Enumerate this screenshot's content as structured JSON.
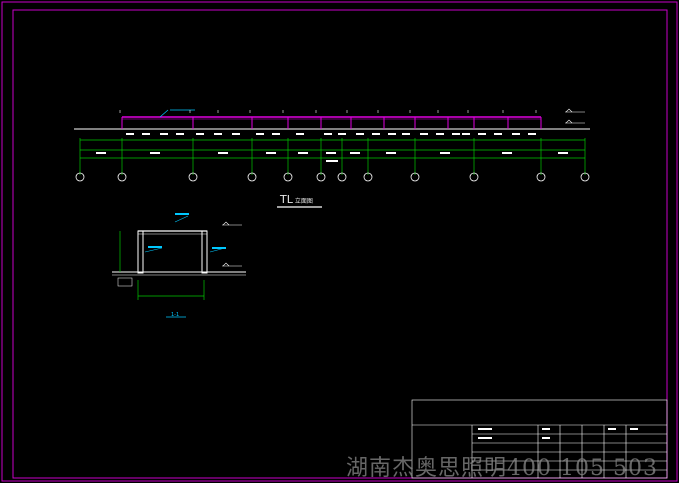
{
  "drawing": {
    "title_main": "TL",
    "title_sub": "立面图",
    "section_label": "1-1",
    "watermark": "湖南杰奥思照明400 105 503",
    "colors": {
      "background": "#000000",
      "frame": "#c800c8",
      "structure": "#e000e0",
      "dimension": "#00c800",
      "text": "#ffffff",
      "section": "#00c8ff"
    }
  }
}
